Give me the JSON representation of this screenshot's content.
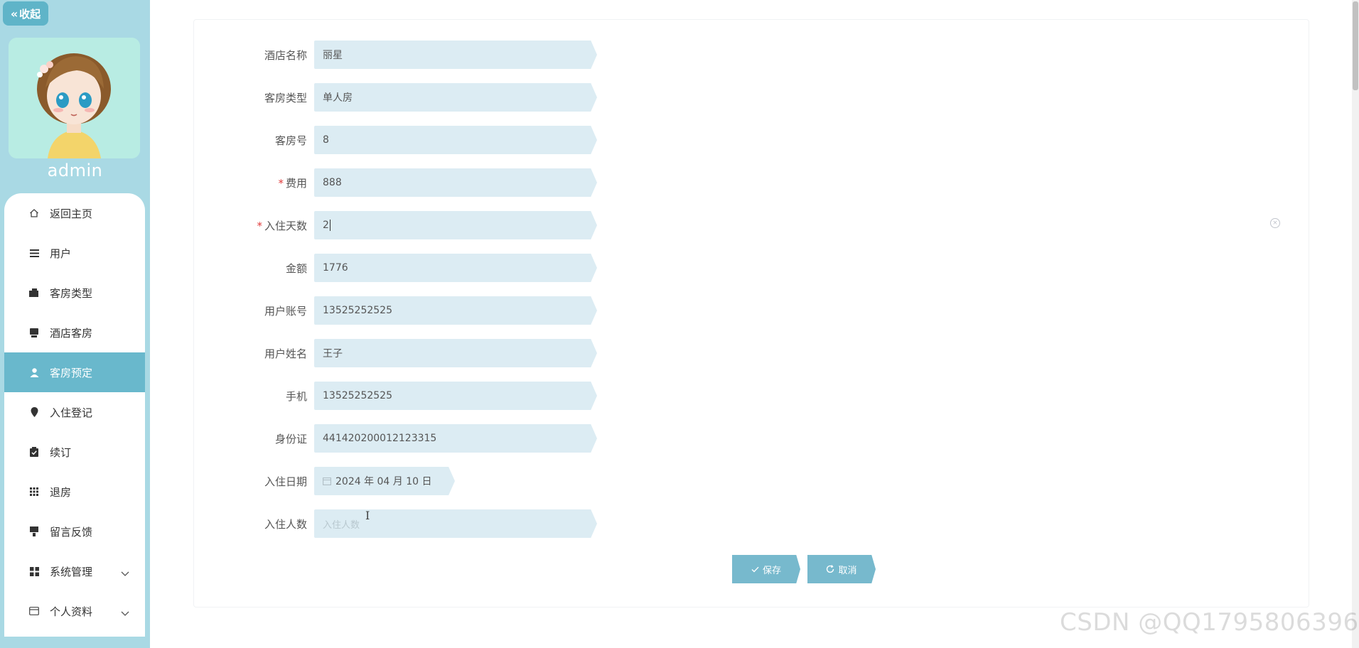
{
  "sidebar": {
    "collapse_label": "收起",
    "username": "admin",
    "accent_color": "#69b8cc",
    "items": [
      {
        "label": "返回主页",
        "icon": "home-icon"
      },
      {
        "label": "用户",
        "icon": "list-icon"
      },
      {
        "label": "客房类型",
        "icon": "wallet-icon"
      },
      {
        "label": "酒店客房",
        "icon": "printer-icon"
      },
      {
        "label": "客房预定",
        "icon": "user-icon",
        "active": true
      },
      {
        "label": "入住登记",
        "icon": "location-icon"
      },
      {
        "label": "续订",
        "icon": "clipboard-check-icon"
      },
      {
        "label": "退房",
        "icon": "grid-icon"
      },
      {
        "label": "留言反馈",
        "icon": "message-icon"
      },
      {
        "label": "系统管理",
        "icon": "apps-icon",
        "expandable": true
      },
      {
        "label": "个人资料",
        "icon": "card-icon",
        "expandable": true
      }
    ]
  },
  "form": {
    "hotel_name": {
      "label": "酒店名称",
      "value": "丽星"
    },
    "room_type": {
      "label": "客房类型",
      "value": "单人房"
    },
    "room_no": {
      "label": "客房号",
      "value": "8"
    },
    "fee": {
      "label": "费用",
      "value": "888",
      "required": true
    },
    "days": {
      "label": "入住天数",
      "value": "2",
      "required": true
    },
    "amount": {
      "label": "金额",
      "value": "1776"
    },
    "account": {
      "label": "用户账号",
      "value": "13525252525"
    },
    "user_name": {
      "label": "用户姓名",
      "value": "王子"
    },
    "phone": {
      "label": "手机",
      "value": "13525252525"
    },
    "id_card": {
      "label": "身份证",
      "value": "441420200012123315"
    },
    "checkin_date": {
      "label": "入住日期",
      "value": "2024 年 04 月 10 日"
    },
    "guests": {
      "label": "入住人数",
      "placeholder": "入住人数"
    }
  },
  "buttons": {
    "save": "保存",
    "cancel": "取消"
  },
  "watermark": "CSDN @QQ1795806396"
}
